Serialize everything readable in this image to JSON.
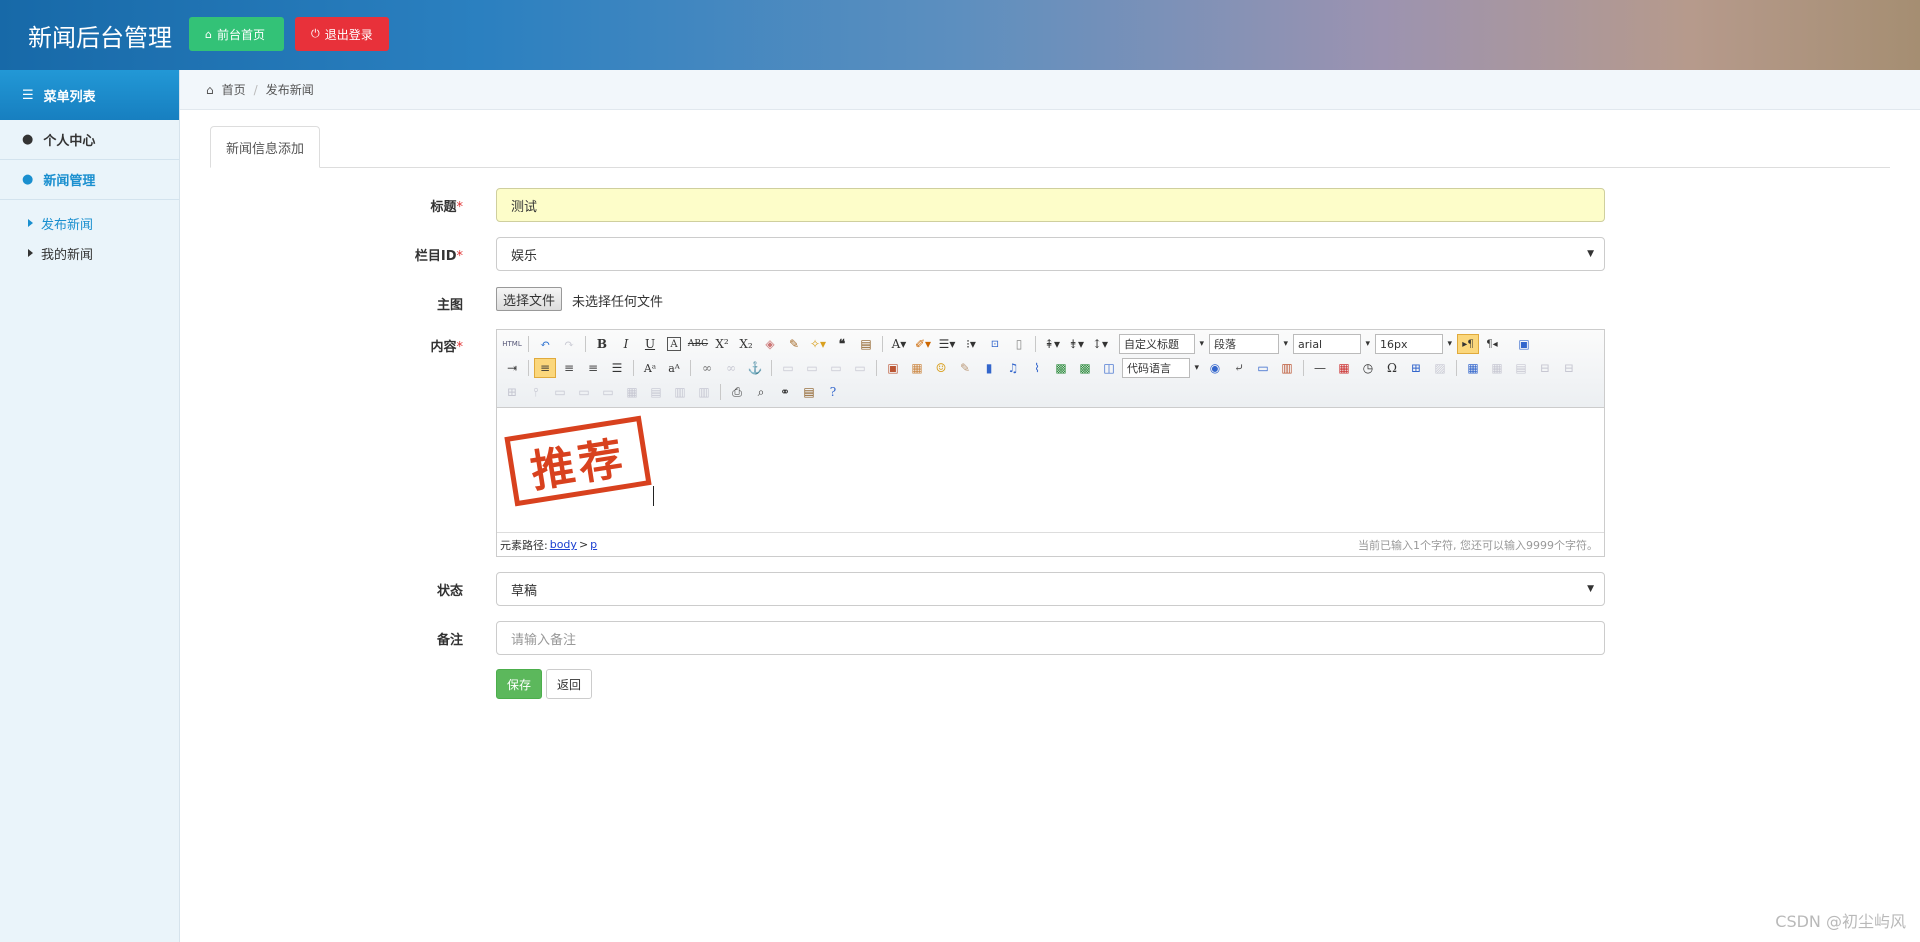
{
  "header": {
    "brand": "新闻后台管理",
    "front_btn": "前台首页",
    "logout_btn": "退出登录"
  },
  "sidebar": {
    "title": "菜单列表",
    "items": [
      {
        "label": "个人中心"
      },
      {
        "label": "新闻管理"
      }
    ],
    "sub_items": [
      {
        "label": "发布新闻"
      },
      {
        "label": "我的新闻"
      }
    ]
  },
  "breadcrumb": {
    "home": "首页",
    "current": "发布新闻"
  },
  "tab": {
    "label": "新闻信息添加"
  },
  "form": {
    "title_label": "标题",
    "title_value": "测试",
    "column_label": "栏目ID",
    "column_value": "娱乐",
    "image_label": "主图",
    "file_button": "选择文件",
    "file_status": "未选择任何文件",
    "content_label": "内容",
    "status_label": "状态",
    "status_value": "草稿",
    "remark_label": "备注",
    "remark_placeholder": "请输入备注",
    "required_mark": "*"
  },
  "editor": {
    "html_btn": "HTML",
    "custom_title": "自定义标题",
    "paragraph": "段落",
    "font_family": "arial",
    "font_size": "16px",
    "code_lang": "代码语言",
    "stamp_text": "推荐",
    "path_label": "元素路径:",
    "path_body": "body",
    "path_sep": ">",
    "path_p": "p",
    "char_count": "当前已输入1个字符, 您还可以输入9999个字符。"
  },
  "buttons": {
    "save": "保存",
    "back": "返回"
  },
  "watermark": "CSDN @初尘屿风",
  "colors": {
    "accent": "#1a8fcf",
    "save": "#5cb85c",
    "logout": "#e8313a",
    "front": "#33c277"
  }
}
